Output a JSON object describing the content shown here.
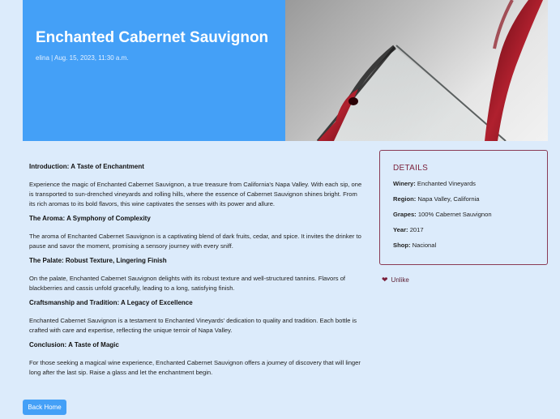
{
  "post": {
    "title": "Enchanted Cabernet Sauvignon",
    "meta": "elina | Aug. 15, 2023, 11:30 a.m."
  },
  "article": {
    "sections": [
      {
        "heading": "Introduction: A Taste of Enchantment",
        "body": "Experience the magic of Enchanted Cabernet Sauvignon, a true treasure from California's Napa Valley. With each sip, one is transported to sun-drenched vineyards and rolling hills, where the essence of Cabernet Sauvignon shines bright. From its rich aromas to its bold flavors, this wine captivates the senses with its power and allure."
      },
      {
        "heading": "The Aroma: A Symphony of Complexity",
        "body": "The aroma of Enchanted Cabernet Sauvignon is a captivating blend of dark fruits, cedar, and spice. It invites the drinker to pause and savor the moment, promising a sensory journey with every sniff."
      },
      {
        "heading": "The Palate: Robust Texture, Lingering Finish",
        "body": "On the palate, Enchanted Cabernet Sauvignon delights with its robust texture and well-structured tannins. Flavors of blackberries and cassis unfold gracefully, leading to a long, satisfying finish."
      },
      {
        "heading": "Craftsmanship and Tradition: A Legacy of Excellence",
        "body": "Enchanted Cabernet Sauvignon is a testament to Enchanted Vineyards' dedication to quality and tradition. Each bottle is crafted with care and expertise, reflecting the unique terroir of Napa Valley."
      },
      {
        "heading": "Conclusion: A Taste of Magic",
        "body": "For those seeking a magical wine experience, Enchanted Cabernet Sauvignon offers a journey of discovery that will linger long after the last sip. Raise a glass and let the enchantment begin."
      }
    ]
  },
  "details": {
    "title": "DETAILS",
    "winery_label": "Winery:",
    "winery": "Enchanted Vineyards",
    "region_label": "Region:",
    "region": "Napa Valley, California",
    "grapes_label": "Grapes:",
    "grapes": "100% Cabernet Sauvignon",
    "year_label": "Year:",
    "year": "2017",
    "shop_label": "Shop:",
    "shop": "Nacional"
  },
  "actions": {
    "unlike_label": "Unlike",
    "back_label": "Back Home"
  },
  "colors": {
    "accent": "#44a0f7",
    "background": "#dcebfb",
    "wine": "#7a1f3a"
  },
  "icons": {
    "like": "heart-icon"
  }
}
